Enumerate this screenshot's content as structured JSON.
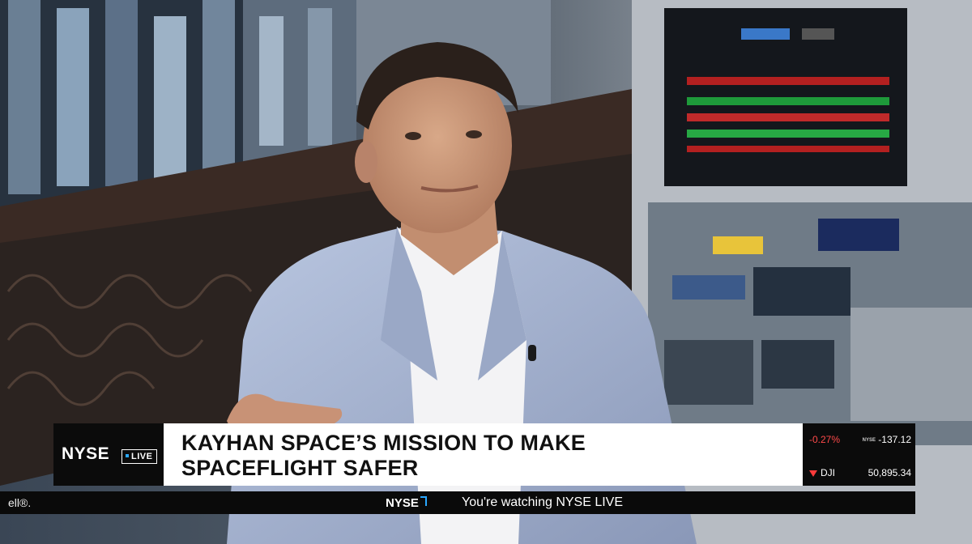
{
  "lower_third": {
    "brand": "NYSE",
    "live_label": "LIVE",
    "headline_line1": "KAYHAN SPACE’S MISSION TO MAKE",
    "headline_line2": "SPACEFLIGHT SAFER",
    "ticker": {
      "row1_change": "-0.27%",
      "row1_mini": "NYSE",
      "row1_value": "-137.12",
      "row2_symbol": "DJI",
      "row2_value": "50,895.34"
    }
  },
  "crawl": {
    "left_fragment": "ell®.",
    "logo": "NYSE",
    "text": "You're watching NYSE LIVE"
  },
  "colors": {
    "accent_blue": "#2aa8ff",
    "down_red": "#ff3b3b",
    "suit": "#a9b7d4"
  }
}
